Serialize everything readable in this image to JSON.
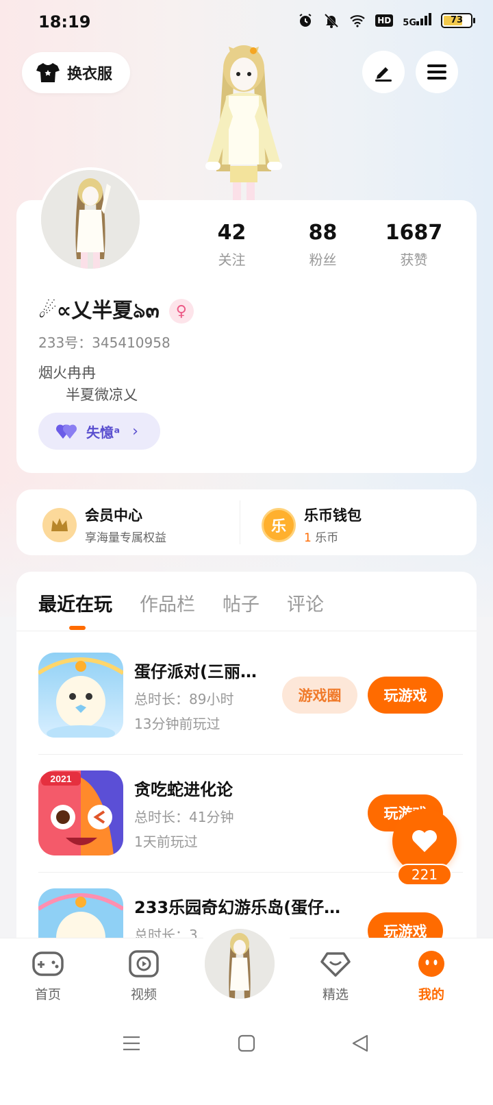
{
  "status_bar": {
    "time": "18:19",
    "network": "5G",
    "hd": "HD",
    "battery": "73"
  },
  "header": {
    "outfit_label": "换衣服"
  },
  "profile": {
    "stats": [
      {
        "num": "42",
        "label": "关注"
      },
      {
        "num": "88",
        "label": "粉丝"
      },
      {
        "num": "1687",
        "label": "获赞"
      }
    ],
    "nickname": "☄︎∝乂半夏ঌ๓",
    "gender_symbol": "♀",
    "uid": "233号：345410958",
    "bio_line1": "烟火冉冉",
    "bio_line2": "半夏微凉乂",
    "cp_tag": "失憶ᵃ"
  },
  "member": {
    "vip_title": "会员中心",
    "vip_sub": "享海量专属权益",
    "wallet_title": "乐币钱包",
    "wallet_amount": "1",
    "wallet_unit": " 乐币",
    "coin_char": "乐"
  },
  "tabs": [
    "最近在玩",
    "作品栏",
    "帖子",
    "评论"
  ],
  "games": [
    {
      "name": "蛋仔派对(三丽…",
      "duration": "总时长：89小时",
      "last": "13分钟前玩过",
      "circle": "游戏圈",
      "play": "玩游戏"
    },
    {
      "name": "贪吃蛇进化论",
      "duration": "总时长：41分钟",
      "last": "1天前玩过",
      "play": "玩游戏",
      "badge": "2021"
    },
    {
      "name": "233乐园奇幻游乐岛(蛋仔…",
      "duration": "总时长：3",
      "play": "玩游戏"
    }
  ],
  "like": {
    "count": "221"
  },
  "bottom_nav": [
    "首页",
    "视频",
    "精选",
    "我的"
  ],
  "colors": {
    "accent": "#ff6b00",
    "purple": "#5a4fcf"
  }
}
